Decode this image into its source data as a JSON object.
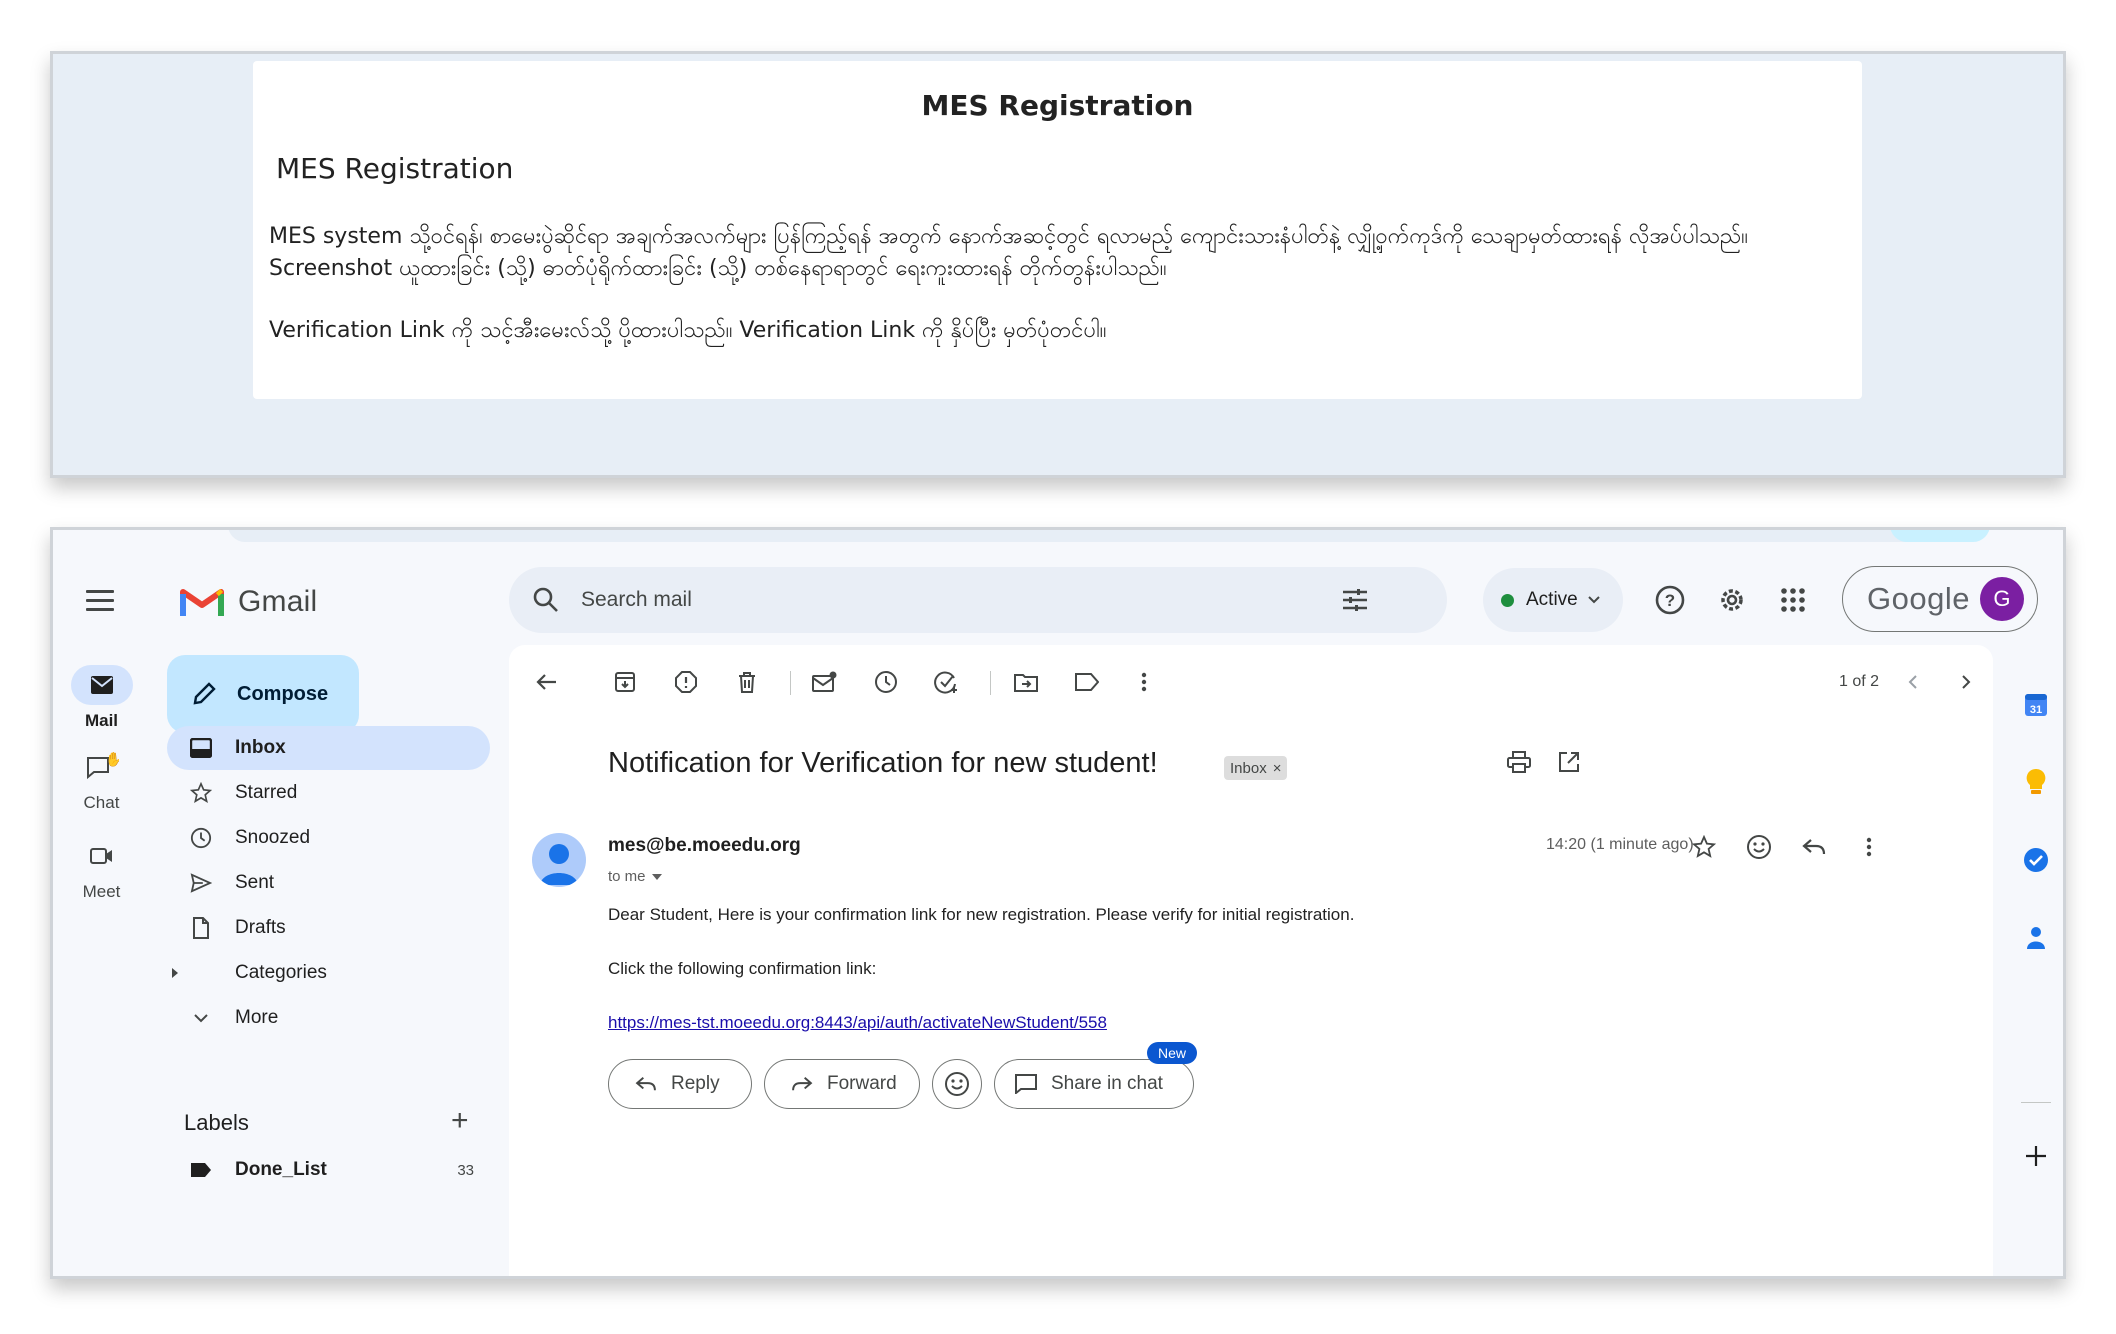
{
  "mes": {
    "header_title": "MES Registration",
    "heading": "MES Registration",
    "paragraph1": "MES system သို့ဝင်ရန်၊ စာမေးပွဲဆိုင်ရာ အချက်အလက်များ ပြန်ကြည့်ရန် အတွက် နောက်အဆင့်တွင် ရလာမည့် ကျောင်းသားနံပါတ်နဲ့ လျှို့ဝှက်ကုဒ်ကို သေချာမှတ်ထားရန် လိုအပ်ပါသည်။ Screenshot ယူထားခြင်း (သို့) ဓာတ်ပုံရိုက်ထားခြင်း (သို့) တစ်နေရာရာတွင် ရေးကူးထားရန် တိုက်တွန်းပါသည်။",
    "paragraph2": "Verification Link ကို သင့်အီးမေးလ်သို့ ပို့ထားပါသည်။ Verification Link ကို နှိပ်ပြီး မှတ်ပုံတင်ပါ။"
  },
  "gmail": {
    "logo_text": "Gmail",
    "rail": [
      {
        "label": "Mail",
        "icon": "mail-icon"
      },
      {
        "label": "Chat",
        "icon": "chat-icon"
      },
      {
        "label": "Meet",
        "icon": "video-icon"
      }
    ],
    "compose_label": "Compose",
    "nav": [
      {
        "label": "Inbox",
        "icon": "inbox-icon"
      },
      {
        "label": "Starred",
        "icon": "star-icon"
      },
      {
        "label": "Snoozed",
        "icon": "clock-icon"
      },
      {
        "label": "Sent",
        "icon": "send-icon"
      },
      {
        "label": "Drafts",
        "icon": "draft-icon"
      },
      {
        "label": "Categories",
        "icon": "caret-right-icon"
      },
      {
        "label": "More",
        "icon": "chevron-down-icon"
      }
    ],
    "labels_heading": "Labels",
    "labels": [
      {
        "name": "Done_List",
        "count": "33"
      }
    ],
    "search_placeholder": "Search mail",
    "status_label": "Active",
    "google_text": "Google",
    "avatar_letter": "G",
    "pager": "1 of 2",
    "subject": "Notification for Verification for new student!",
    "inbox_chip": "Inbox",
    "sender": "mes@be.moeedu.org",
    "to_me": "to me",
    "timestamp": "14:20 (1 minute ago)",
    "body_line1": "Dear Student, Here is your confirmation link for new registration. Please verify for initial registration.",
    "body_line2": "Click the following confirmation link:",
    "link": "https://mes-tst.moeedu.org:8443/api/auth/activateNewStudent/558",
    "actions": {
      "reply": "Reply",
      "forward": "Forward",
      "share": "Share in chat",
      "new_badge": "New"
    },
    "right_rail": {
      "calendar_day": "31"
    },
    "colors": {
      "accent_blue": "#0b57d0",
      "active_green": "#1e8e3e",
      "compose_bg": "#c2e7ff",
      "nav_active_bg": "#d3e3fd",
      "avatar_purple": "#7b1fa2"
    }
  }
}
